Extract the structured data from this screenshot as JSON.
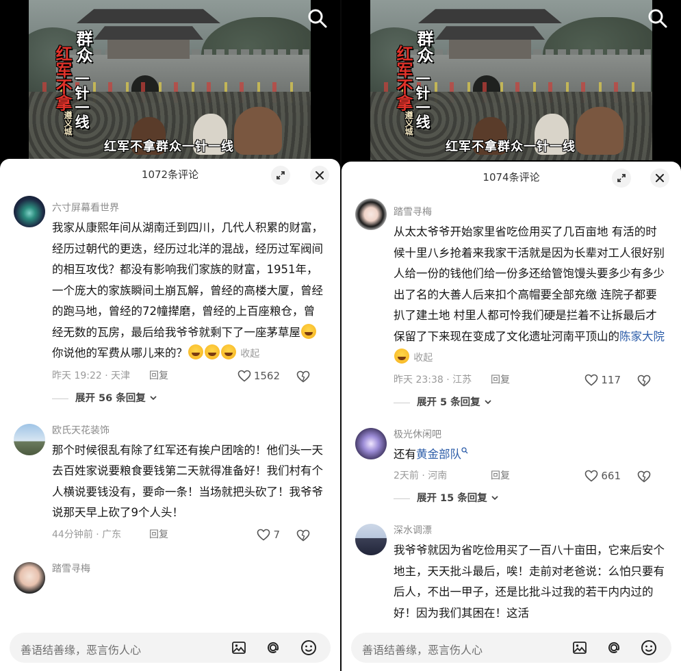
{
  "video_overlay": {
    "red_column": "红军不拿",
    "white_column_1": "群众",
    "white_column_2": "一针一线",
    "small_column": "遵义城",
    "subtitle": "红军不拿群众一针一线"
  },
  "left": {
    "comment_count": "1072条评论",
    "comments": [
      {
        "user": "六寸屏幕看世界",
        "text": "我家从康熙年间从湖南迁到四川，几代人积累的财富，经历过朝代的更迭，经历过北洋的混战，经历过军阀间的相互攻伐？都没有影响我们家族的财富，1951年，一个庞大的家族瞬间土崩瓦解，曾经的高楼大厦，曾经的跑马地，曾经的72幢撵磨，曾经的上百座粮仓，曾经无数的瓦房，最后给我爷爷就剩下了一座茅草屋",
        "text_after_emoji": "你说他的军费从哪儿来的？",
        "fold": "收起",
        "time": "昨天 19:22 · 天津",
        "reply": "回复",
        "likes": "1562",
        "expand": "展开 56 条回复"
      },
      {
        "user": "欧氏天花装饰",
        "text": "那个时候很乱有除了红军还有挨户团啥的！他们头一天去百姓家说要粮食要钱第二天就得准备好！我们村有个人横说要钱没有，要命一条！当场就把头砍了！我爷爷说那天早上砍了9个人头！",
        "time": "44分钟前 · 广东",
        "reply": "回复",
        "likes": "7"
      },
      {
        "user": "踏雪寻梅"
      }
    ]
  },
  "right": {
    "comment_count": "1074条评论",
    "comments": [
      {
        "user": "踏雪寻梅",
        "text": "从太太爷爷开始家里省吃俭用买了几百亩地 有活的时候十里八乡抢着来我家干活就是因为长辈对工人很好别人给一份的钱他们给一份多还给管饱馒头要多少有多少出了名的大善人后来扣个高帽要全部充缴 连院子都要扒了建土地 村里人都可怜我们硬是拦着不让拆最后才保留了下来现在变成了文化遗址河南平顶山的",
        "link": "陈家大院",
        "fold": "收起",
        "time": "昨天 23:38 · 江苏",
        "reply": "回复",
        "likes": "117",
        "expand": "展开 5 条回复"
      },
      {
        "user": "极光休闲吧",
        "text": "还有",
        "link": "黄金部队",
        "time": "2天前 · 河南",
        "reply": "回复",
        "likes": "661",
        "expand": "展开 15 条回复"
      },
      {
        "user": "深水调漂",
        "text": "我爷爷就因为省吃俭用买了一百八十亩田，它来后安个地主，天天批斗最后，唉！走前对老爸说：么怕只要有后人，不出一甲子，还是比批斗过我的若干内内过的好！因为我们其困在！这活"
      }
    ]
  },
  "input": {
    "placeholder": "善语结善缘，恶言伤人心"
  },
  "colors": {
    "link": "#2b5ca8",
    "sheet_bg": "#ffffff",
    "input_bg": "#f3f3f3"
  }
}
